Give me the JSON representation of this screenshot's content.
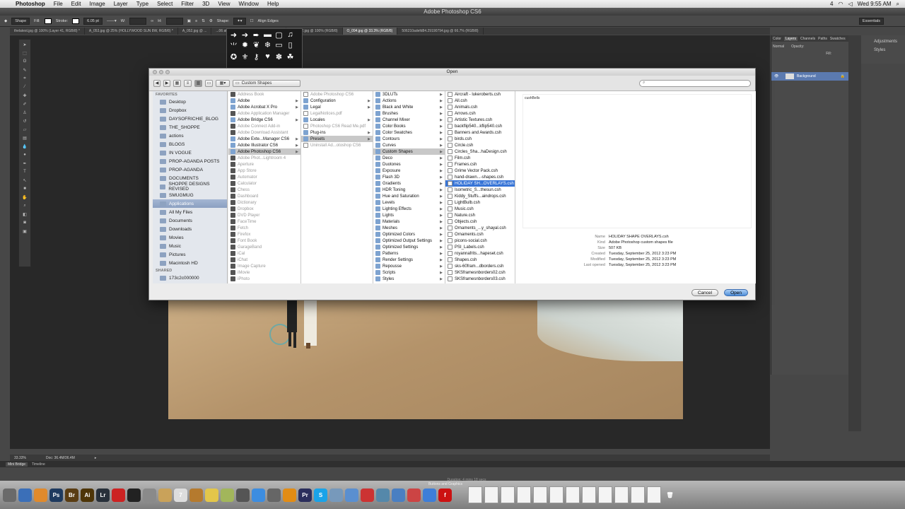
{
  "menubar": {
    "app_name": "Photoshop",
    "menus": [
      "File",
      "Edit",
      "Image",
      "Layer",
      "Type",
      "Select",
      "Filter",
      "3D",
      "View",
      "Window",
      "Help"
    ],
    "clock": "Wed 9:55 AM",
    "battery": "4"
  },
  "window_title": "Adobe Photoshop CS6",
  "options_bar": {
    "tool_label": "Shape",
    "fill_label": "Fill:",
    "stroke_label": "Stroke:",
    "stroke_width": "6.05 pt",
    "w_label": "W:",
    "h_label": "H:",
    "shape_label": "Shape:",
    "align_edges": "Align Edges",
    "workspace": "Essentials"
  },
  "doc_tabs": [
    "thelatest.jpg @ 100% (Layer 41, RGB/8) *",
    "A_053.jpg @ 25% (HOLLYWOOD SUN 8W, RGB/8) *",
    "A_052.jpg @ ...",
    "...06 at 3.26.31 PM.png @ 100% (RGB/8)",
    "header2.jpg @ 100% (RGB/8)",
    "O_094.jpg @ 33.3% (RGB/8)",
    "506210adefd84.29190794.jpg @ 66.7% (RGB/8)"
  ],
  "right_panel": {
    "tabs": [
      "Color",
      "Layers",
      "Channels",
      "Paths",
      "Swatches"
    ],
    "blend": "Normal",
    "opacity": "Opacity:",
    "fill": "Fill:",
    "layer": "Background",
    "adjustments": "Adjustments",
    "styles": "Styles"
  },
  "status": {
    "zoom": "33.33%",
    "doc": "Doc: 36.4M/36.4M"
  },
  "minibridge": {
    "tabs": [
      "Mini Bridge",
      "Timeline"
    ]
  },
  "dock_duration": "Duration: 4 mins 18 secs",
  "dock_caption": "Buttons and Graphics",
  "dialog": {
    "title": "Open",
    "path_popup": "Custom Shapes",
    "search_placeholder": "",
    "sidebar": {
      "favorites_label": "FAVORITES",
      "favorites": [
        "Desktop",
        "Dropbox",
        "DAYSOFRICHIE_BLOG",
        "THE_SHOPPE",
        "actions",
        "BLOGS",
        "IN VOGUE",
        "PROP-AGANDA POSTS",
        "PROP-AGANDA",
        "DOCUMENTS",
        "SHOPPE DESIGNS REVISED",
        "SMUGMUG",
        "Applications",
        "All My Files",
        "Documents",
        "Downloads",
        "Movies",
        "Music",
        "Pictures",
        "Macintosh HD"
      ],
      "selected": "Applications",
      "shared_label": "SHARED",
      "shared": [
        "173c2c000000"
      ]
    },
    "col1": [
      {
        "t": "Address Book",
        "dim": true
      },
      {
        "t": "Adobe",
        "arr": true
      },
      {
        "t": "Adobe Acrobat X Pro",
        "arr": true
      },
      {
        "t": "Adobe Application Manager",
        "dim": true
      },
      {
        "t": "Adobe Bridge CS6",
        "arr": true
      },
      {
        "t": "Adobe Connect Add-in",
        "dim": true
      },
      {
        "t": "Adobe Download Assistant",
        "dim": true
      },
      {
        "t": "Adobe Exte...Manager CS6",
        "arr": true
      },
      {
        "t": "Adobe Illustrator CS6",
        "arr": true
      },
      {
        "t": "Adobe Photoshop CS6",
        "arr": true,
        "sel": true
      },
      {
        "t": "Adobe Phot...Lightroom 4",
        "dim": true
      },
      {
        "t": "Aperture",
        "dim": true
      },
      {
        "t": "App Store",
        "dim": true
      },
      {
        "t": "Automator",
        "dim": true
      },
      {
        "t": "Calculator",
        "dim": true
      },
      {
        "t": "Chess",
        "dim": true
      },
      {
        "t": "Dashboard",
        "dim": true
      },
      {
        "t": "Dictionary",
        "dim": true
      },
      {
        "t": "Dropbox",
        "dim": true
      },
      {
        "t": "DVD Player",
        "dim": true
      },
      {
        "t": "FaceTime",
        "dim": true
      },
      {
        "t": "Fetch",
        "dim": true
      },
      {
        "t": "Firefox",
        "dim": true
      },
      {
        "t": "Font Book",
        "dim": true
      },
      {
        "t": "GarageBand",
        "dim": true
      },
      {
        "t": "iCal",
        "dim": true
      },
      {
        "t": "iChat",
        "dim": true
      },
      {
        "t": "Image Capture",
        "dim": true
      },
      {
        "t": "iMovie",
        "dim": true
      },
      {
        "t": "iPhoto",
        "dim": true
      }
    ],
    "col2": [
      {
        "t": "Adobe Photoshop CS6",
        "dim": true
      },
      {
        "t": "Configuration",
        "arr": true
      },
      {
        "t": "Legal",
        "arr": true
      },
      {
        "t": "LegalNotices.pdf",
        "dim": true
      },
      {
        "t": "Locales",
        "arr": true
      },
      {
        "t": "Photoshop CS6 Read Me.pdf",
        "dim": true
      },
      {
        "t": "Plug-ins",
        "arr": true
      },
      {
        "t": "Presets",
        "arr": true,
        "sel": true
      },
      {
        "t": "Uninstall Ad...otoshop CS6",
        "dim": true
      }
    ],
    "col3": [
      {
        "t": "3DLUTs",
        "arr": true
      },
      {
        "t": "Actions",
        "arr": true
      },
      {
        "t": "Black and White",
        "arr": true
      },
      {
        "t": "Brushes",
        "arr": true
      },
      {
        "t": "Channel Mixer",
        "arr": true
      },
      {
        "t": "Color Books",
        "arr": true
      },
      {
        "t": "Color Swatches",
        "arr": true
      },
      {
        "t": "Contours",
        "arr": true
      },
      {
        "t": "Curves",
        "arr": true
      },
      {
        "t": "Custom Shapes",
        "arr": true,
        "sel": true
      },
      {
        "t": "Deco",
        "arr": true
      },
      {
        "t": "Duotones",
        "arr": true
      },
      {
        "t": "Exposure",
        "arr": true
      },
      {
        "t": "Flash 3D",
        "arr": true
      },
      {
        "t": "Gradients",
        "arr": true
      },
      {
        "t": "HDR Toning",
        "arr": true
      },
      {
        "t": "Hue and Saturation",
        "arr": true
      },
      {
        "t": "Levels",
        "arr": true
      },
      {
        "t": "Lighting Effects",
        "arr": true
      },
      {
        "t": "Lights",
        "arr": true
      },
      {
        "t": "Materials",
        "arr": true
      },
      {
        "t": "Meshes",
        "arr": true
      },
      {
        "t": "Optimized Colors",
        "arr": true
      },
      {
        "t": "Optimized Output Settings",
        "arr": true
      },
      {
        "t": "Optimized Settings",
        "arr": true
      },
      {
        "t": "Patterns",
        "arr": true
      },
      {
        "t": "Render Settings",
        "arr": true
      },
      {
        "t": "Repousse",
        "arr": true
      },
      {
        "t": "Scripts",
        "arr": true
      },
      {
        "t": "Styles",
        "arr": true
      }
    ],
    "col4": [
      {
        "t": "Aircraft - lukeroberts.csh"
      },
      {
        "t": "All.csh"
      },
      {
        "t": "Animals.csh"
      },
      {
        "t": "Arrows.csh"
      },
      {
        "t": "Artistic Textures.csh"
      },
      {
        "t": "backflip540...kflip540.csh"
      },
      {
        "t": "Banners and Awards.csh"
      },
      {
        "t": "birds.csh"
      },
      {
        "t": "Circle.csh"
      },
      {
        "t": "Circles_Sha...haDesign.csh"
      },
      {
        "t": "Film.csh"
      },
      {
        "t": "Frames.csh"
      },
      {
        "t": "Grime Vector Pack.csh"
      },
      {
        "t": "hand-drawn...-shapes.csh"
      },
      {
        "t": "HOLIDAY SH...OVERLAYS.csh",
        "hi": true
      },
      {
        "t": "Isometric_S...thesun.csh"
      },
      {
        "t": "Kiddy_Stuffs...aindrops.csh"
      },
      {
        "t": "LightBulb.csh"
      },
      {
        "t": "Music.csh"
      },
      {
        "t": "Nature.csh"
      },
      {
        "t": "Objects.csh"
      },
      {
        "t": "Ornaments_...y_shayal.csh"
      },
      {
        "t": "Ornaments.csh"
      },
      {
        "t": "picons-social.csh"
      },
      {
        "t": "PSI_Labels.csh"
      },
      {
        "t": "royannafrits...hapeset.csh"
      },
      {
        "t": "Shapes.csh"
      },
      {
        "t": "sks-60fram...dborders.csh"
      },
      {
        "t": "SKSframesnborders02.csh"
      },
      {
        "t": "SKSframesnborders03.csh"
      }
    ],
    "preview_text": "cushBells",
    "meta": [
      {
        "k": "Name",
        "v": "HOLIDAY SHAPE OVERLAYS.csh"
      },
      {
        "k": "Kind",
        "v": "Adobe Photoshop custom shapes file"
      },
      {
        "k": "Size",
        "v": "507 KB"
      },
      {
        "k": "Created",
        "v": "Tuesday, September 25, 2012 3:23 PM"
      },
      {
        "k": "Modified",
        "v": "Tuesday, September 25, 2012 3:23 PM"
      },
      {
        "k": "Last opened",
        "v": "Tuesday, September 25, 2012 3:23 PM"
      }
    ],
    "cancel": "Cancel",
    "open": "Open"
  },
  "dock_apps": [
    {
      "label": "",
      "color": "#6a6a6a"
    },
    {
      "label": "",
      "color": "#3b6fb8"
    },
    {
      "label": "",
      "color": "#e08a2c"
    },
    {
      "label": "Ps",
      "color": "#1e3a5f"
    },
    {
      "label": "Br",
      "color": "#5a3d13"
    },
    {
      "label": "Ai",
      "color": "#4e3508"
    },
    {
      "label": "Lr",
      "color": "#28303a"
    },
    {
      "label": "",
      "color": "#c22"
    },
    {
      "label": "",
      "color": "#222"
    },
    {
      "label": "",
      "color": "#8a8a8a"
    },
    {
      "label": "",
      "color": "#c9a25a"
    },
    {
      "label": "7",
      "color": "#ddd"
    },
    {
      "label": "",
      "color": "#b57a2e"
    },
    {
      "label": "",
      "color": "#e3c64a"
    },
    {
      "label": "",
      "color": "#a2b65b"
    },
    {
      "label": "",
      "color": "#555"
    },
    {
      "label": "",
      "color": "#3d8de0"
    },
    {
      "label": "",
      "color": "#666"
    },
    {
      "label": "",
      "color": "#e28c15"
    },
    {
      "label": "Pr",
      "color": "#2b2e5c"
    },
    {
      "label": "S",
      "color": "#1aa3e8"
    },
    {
      "label": "",
      "color": "#79b"
    },
    {
      "label": "",
      "color": "#5a8fd0"
    },
    {
      "label": "",
      "color": "#c33"
    },
    {
      "label": "",
      "color": "#58a"
    },
    {
      "label": "",
      "color": "#4a7fc2"
    },
    {
      "label": "",
      "color": "#c44"
    },
    {
      "label": "",
      "color": "#3e7ed8"
    },
    {
      "label": "f",
      "color": "#c11"
    }
  ]
}
